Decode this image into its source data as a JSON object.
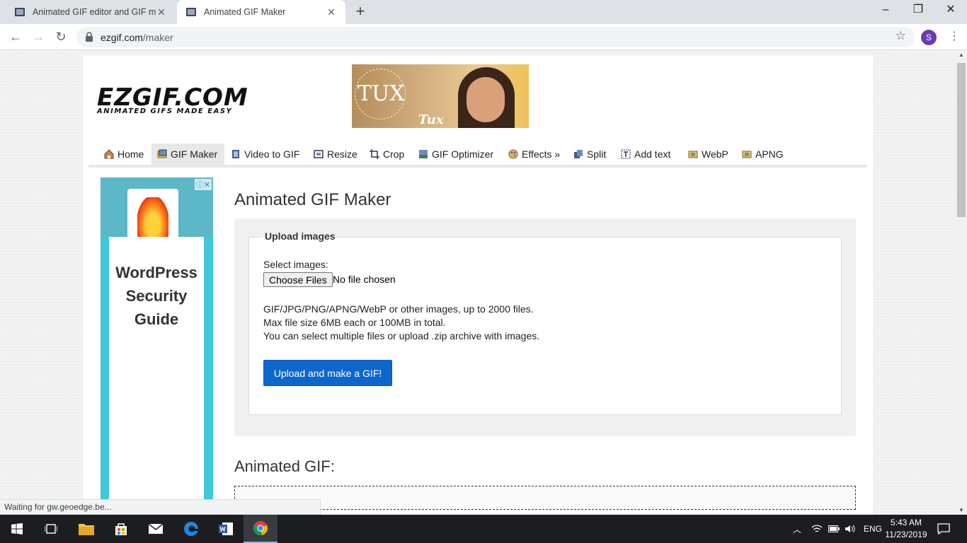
{
  "browser": {
    "tabs": [
      {
        "title": "Animated GIF editor and GIF mak",
        "active": false
      },
      {
        "title": "Animated GIF Maker",
        "active": true
      }
    ],
    "url_host": "ezgif.com",
    "url_path": "/maker",
    "profile_initial": "S",
    "status_text": "Waiting for gw.geoedge.be..."
  },
  "site": {
    "logo_main": "EZGIF.COM",
    "logo_tagline": "ANIMATED GIFS MADE EASY",
    "ad_top_brand": "TUX",
    "ad_top_script": "Tux",
    "menu": [
      {
        "label": "Home"
      },
      {
        "label": "GIF Maker"
      },
      {
        "label": "Video to GIF"
      },
      {
        "label": "Resize"
      },
      {
        "label": "Crop"
      },
      {
        "label": "GIF Optimizer"
      },
      {
        "label": "Effects »"
      },
      {
        "label": "Split"
      },
      {
        "label": "Add text"
      },
      {
        "label": "WebP"
      },
      {
        "label": "APNG"
      }
    ],
    "side_ad_text": "WordPress Security Guide"
  },
  "main": {
    "title": "Animated GIF Maker",
    "upload_legend": "Upload images",
    "select_label": "Select images:",
    "choose_button": "Choose Files",
    "no_file": "No file chosen",
    "info_lines": [
      "GIF/JPG/PNG/APNG/WebP or other images, up to 2000 files.",
      "Max file size 6MB each or 100MB in total.",
      "You can select multiple files or upload .zip archive with images."
    ],
    "upload_button": "Upload and make a GIF!",
    "animated_heading": "Animated GIF:"
  },
  "taskbar": {
    "language": "ENG",
    "time": "5:43 AM",
    "date": "11/23/2019"
  },
  "colors": {
    "accent_button": "#0c67cd",
    "tab_strip": "#dee1e6",
    "taskbar": "#1c1d21"
  }
}
